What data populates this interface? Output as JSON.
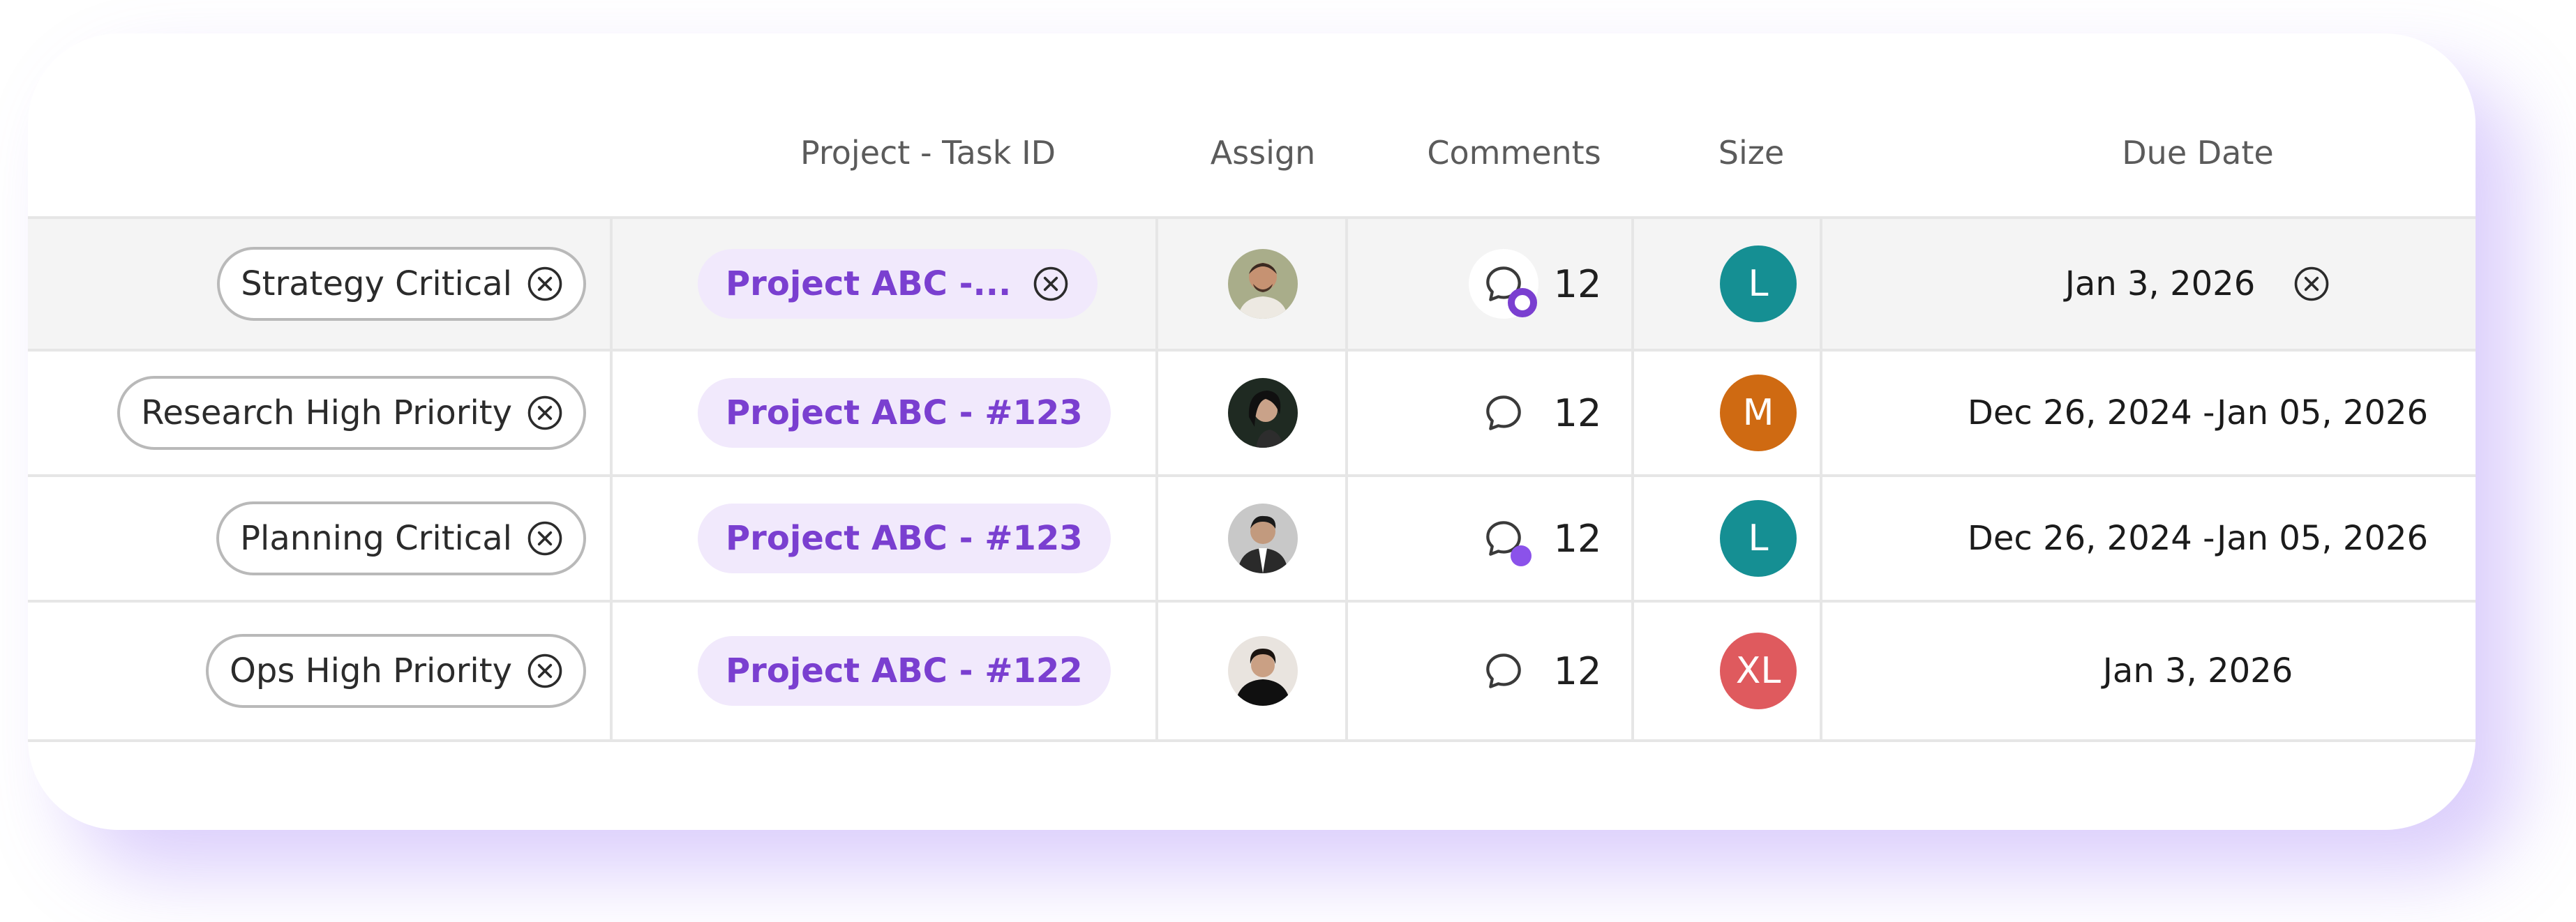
{
  "headers": {
    "project": "Project - Task ID",
    "assign": "Assign",
    "comments": "Comments",
    "size": "Size",
    "due": "Due Date"
  },
  "rows": [
    {
      "label": "Strategy Critical",
      "project": "Project ABC -...",
      "comments": "12",
      "comment_badge": "ring",
      "size": "L",
      "size_color": "#158f93",
      "due": "Jan 3, 2026",
      "due_clearable": true
    },
    {
      "label": "Research High Priority",
      "project": "Project ABC - #123",
      "comments": "12",
      "comment_badge": "none",
      "size": "M",
      "size_color": "#cf6a12",
      "due": "Dec 26, 2024  -Jan 05, 2026",
      "due_clearable": false
    },
    {
      "label": "Planning Critical",
      "project": "Project ABC - #123",
      "comments": "12",
      "comment_badge": "dot",
      "size": "L",
      "size_color": "#158f93",
      "due": "Dec 26, 2024  -Jan 05, 2026",
      "due_clearable": false
    },
    {
      "label": "Ops High Priority",
      "project": "Project ABC - #122",
      "comments": "12",
      "comment_badge": "none",
      "size": "XL",
      "size_color": "#df5a5e",
      "due": "Jan 3, 2026",
      "due_clearable": false
    }
  ],
  "colors": {
    "accent": "#7a3fd0",
    "chip_bg": "#f1e9fc",
    "row_highlight": "#f4f4f4"
  },
  "icons": {
    "remove": "circle-x-icon",
    "comment": "speech-bubble-icon",
    "avatar": "user-avatar"
  }
}
